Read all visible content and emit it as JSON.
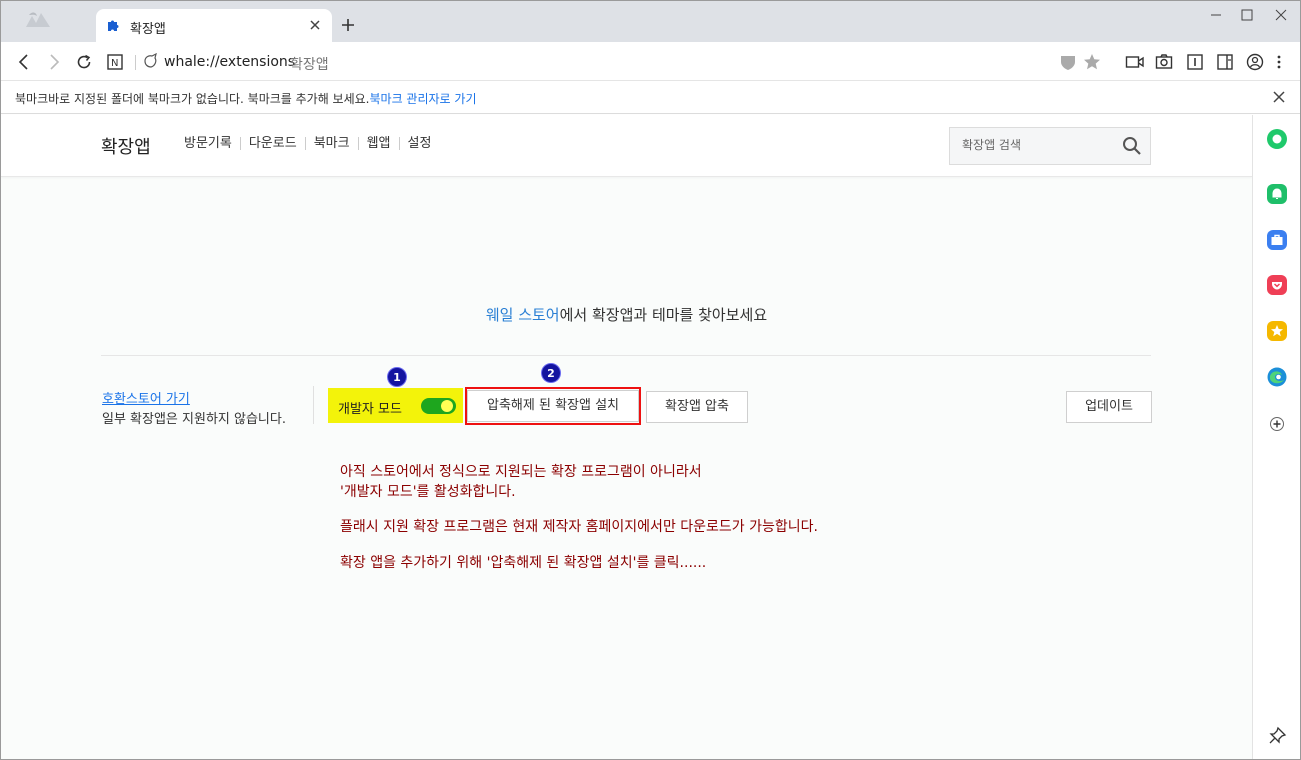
{
  "browser": {
    "tab_title": "확장앱",
    "url": "whale://extensions",
    "url_title": "확장앱"
  },
  "bookmark_bar": {
    "message": "북마크바로 지정된 폴더에 북마크가 없습니다. 북마크를 추가해 보세요.",
    "link": "북마크 관리자로 가기"
  },
  "header": {
    "title": "확장앱",
    "nav": [
      "방문기록",
      "다운로드",
      "북마크",
      "웹앱",
      "설정"
    ],
    "search_placeholder": "확장앱 검색"
  },
  "store": {
    "link": "웨일 스토어",
    "text": "에서 확장앱과 테마를 찾아보세요"
  },
  "compat": {
    "link": "호환스토어 가기",
    "desc": "일부 확장앱은 지원하지 않습니다."
  },
  "developer_mode": {
    "label": "개발자 모드",
    "enabled": true
  },
  "buttons": {
    "load_unpacked": "압축해제 된 확장앱 설치",
    "pack": "확장앱 압축",
    "update": "업데이트"
  },
  "badges": [
    "1",
    "2"
  ],
  "notes": [
    "아직 스토어에서 정식으로 지원되는 확장 프로그램이 아니라서",
    "'개발자 모드'를 활성화합니다.",
    "플래시 지원 확장 프로그램은 현재 제작자 홈페이지에서만 다운로드가 가능합니다.",
    "확장 앱을 추가하기 위해 '압축해제 된 확장앱 설치'를 클릭......"
  ],
  "colors": {
    "highlight_yellow": "#f3f30a",
    "note_red": "#8b0000",
    "link_blue": "#1a73e8",
    "toggle_green": "#1ea61e"
  },
  "sidebar_icons": [
    "whale-green-icon",
    "bell-icon",
    "briefcase-icon",
    "pocket-icon",
    "star-icon",
    "edge-icon",
    "add-icon",
    "pin-icon"
  ]
}
